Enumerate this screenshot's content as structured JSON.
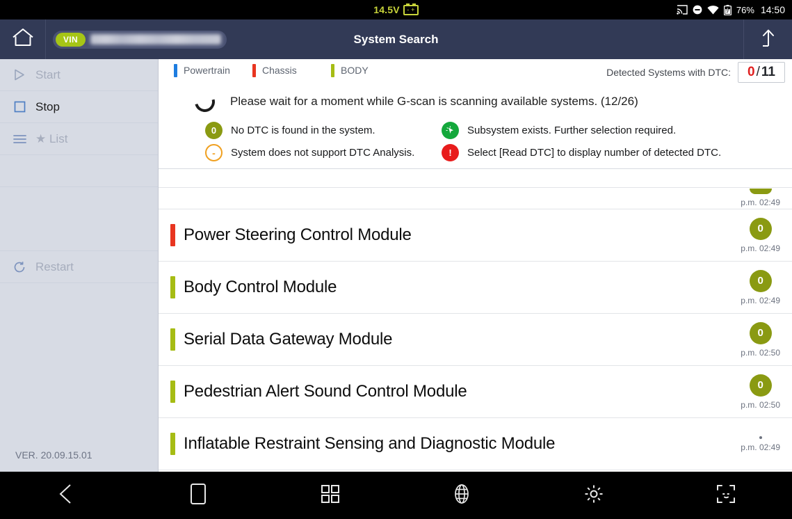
{
  "statusbar": {
    "voltage": "14.5V",
    "battery_icon": "car-battery-icon",
    "cast_icon": "screen-cast-icon",
    "dnd_icon": "do-not-disturb-icon",
    "wifi_icon": "wifi-icon",
    "battery_level_icon": "battery-charging-icon",
    "battery_percent": "76%",
    "clock": "14:50"
  },
  "titlebar": {
    "home_icon": "home-icon",
    "vin_tag": "VIN",
    "vin_value": "",
    "title": "System Search",
    "exit_icon": "up-arrow-exit-icon"
  },
  "sidebar": {
    "items": [
      {
        "label": "Start",
        "icon": "play-triangle-icon",
        "enabled": false
      },
      {
        "label": "Stop",
        "icon": "stop-square-icon",
        "enabled": true
      },
      {
        "label": "★ List",
        "icon": "list-lines-icon",
        "enabled": false
      },
      {
        "label": "Restart",
        "icon": "restart-arrow-icon",
        "enabled": false
      }
    ],
    "version": "VER. 20.09.15.01"
  },
  "tabs": [
    {
      "label": "Powertrain",
      "color": "#1e7de0"
    },
    {
      "label": "Chassis",
      "color": "#e83520"
    },
    {
      "label": "BODY",
      "color": "#a6bc14"
    }
  ],
  "dtc_counter": {
    "label": "Detected Systems with DTC:",
    "detected": "0",
    "separator": "/",
    "total": "11"
  },
  "notice": {
    "spinner_icon": "loading-spinner-icon",
    "text": "Please wait for a moment while G-scan is scanning available systems. (12/26)"
  },
  "legend": [
    {
      "icon": "olive-zero-badge-icon",
      "badge": "0",
      "style": "olive",
      "text": "No DTC is found in the system."
    },
    {
      "icon": "orange-ring-dash-icon",
      "badge": "-",
      "style": "ring",
      "text": "System does not support DTC Analysis."
    },
    {
      "icon": "green-subsystem-icon",
      "badge": "",
      "style": "green",
      "text": "Subsystem exists. Further selection required."
    },
    {
      "icon": "red-exclamation-icon",
      "badge": "!",
      "style": "red",
      "text": "Select [Read DTC] to display number of detected DTC."
    }
  ],
  "systems": [
    {
      "name": "",
      "bar_color": "#a6bc14",
      "badge": "",
      "time": "p.m. 02:49",
      "partial_top": true
    },
    {
      "name": "Power Steering Control Module",
      "bar_color": "#e83520",
      "badge": "0",
      "time": "p.m. 02:49"
    },
    {
      "name": "Body Control Module",
      "bar_color": "#a6bc14",
      "badge": "0",
      "time": "p.m. 02:49"
    },
    {
      "name": "Serial Data Gateway Module",
      "bar_color": "#a6bc14",
      "badge": "0",
      "time": "p.m. 02:50"
    },
    {
      "name": "Pedestrian Alert Sound Control Module",
      "bar_color": "#a6bc14",
      "badge": "0",
      "time": "p.m. 02:50"
    },
    {
      "name": "Inflatable Restraint Sensing and Diagnostic Module",
      "bar_color": "#a6bc14",
      "badge": "",
      "time": "p.m. 02:49",
      "partial_bottom": true
    }
  ],
  "navbar": [
    {
      "icon": "back-triangle-icon"
    },
    {
      "icon": "home-rectangle-icon"
    },
    {
      "icon": "recents-grid-icon"
    },
    {
      "icon": "globe-browser-icon"
    },
    {
      "icon": "settings-gear-icon"
    },
    {
      "icon": "screenshot-capture-icon"
    }
  ]
}
